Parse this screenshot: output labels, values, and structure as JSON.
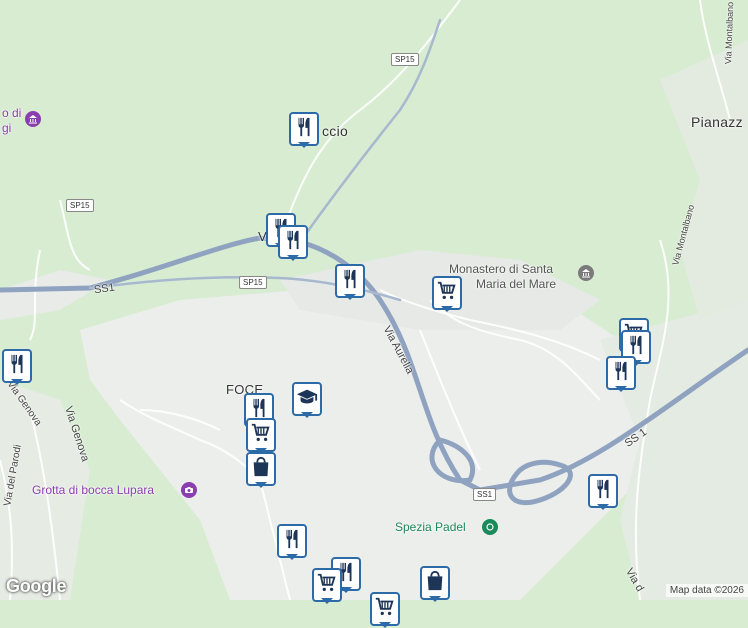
{
  "map": {
    "places": [
      {
        "key": "pianazze",
        "text": "Pianazz"
      },
      {
        "key": "foce",
        "text": "FOCE"
      },
      {
        "key": "accio",
        "text": "ccio"
      },
      {
        "key": "va",
        "text": "Va"
      }
    ],
    "pois": [
      {
        "key": "monastero",
        "line1": "Monastero di Santa",
        "line2": "Maria del Mare",
        "icon": "museum-icon"
      },
      {
        "key": "grotta",
        "text": "Grotta di bocca Lupara",
        "icon": "camera-icon"
      },
      {
        "key": "spezia_padel",
        "text": "Spezia Padel",
        "icon": "sports-icon"
      },
      {
        "key": "left_poi",
        "line1": "o di",
        "line2": "gi",
        "icon": "museum-icon"
      }
    ],
    "roads": [
      {
        "key": "via_aurelia",
        "text": "Via Aurelia"
      },
      {
        "key": "via_genova",
        "text": "Via Genova"
      },
      {
        "key": "via_montalbano_1",
        "text": "Via Montalbano"
      },
      {
        "key": "via_montalbano_2",
        "text": "Via Montalbano"
      },
      {
        "key": "via_del_parodi",
        "text": "Via del Parodi"
      },
      {
        "key": "via_genova_2",
        "text": "Via Genova"
      },
      {
        "key": "via_bottom",
        "text": "Via d"
      }
    ],
    "shields": [
      {
        "key": "sp15_top",
        "text": "SP15"
      },
      {
        "key": "sp15_left",
        "text": "SP15"
      },
      {
        "key": "sp15_mid",
        "text": "SP15"
      },
      {
        "key": "ss1_left",
        "text": "SS1"
      },
      {
        "key": "ss1_bottom",
        "text": "SS1"
      },
      {
        "key": "ss1_right",
        "text": "SS 1"
      }
    ],
    "markers": [
      {
        "type": "restaurant",
        "icon": "fork-knife-icon"
      },
      {
        "type": "restaurant",
        "icon": "fork-knife-icon"
      },
      {
        "type": "restaurant",
        "icon": "fork-knife-icon"
      },
      {
        "type": "restaurant",
        "icon": "fork-knife-icon"
      },
      {
        "type": "grocery",
        "icon": "shopping-cart-icon"
      },
      {
        "type": "restaurant",
        "icon": "fork-knife-icon"
      },
      {
        "type": "grocery",
        "icon": "shopping-cart-icon"
      },
      {
        "type": "restaurant",
        "icon": "fork-knife-icon"
      },
      {
        "type": "restaurant",
        "icon": "fork-knife-icon"
      },
      {
        "type": "restaurant",
        "icon": "fork-knife-icon"
      },
      {
        "type": "school",
        "icon": "graduation-cap-icon"
      },
      {
        "type": "restaurant",
        "icon": "fork-knife-icon"
      },
      {
        "type": "grocery",
        "icon": "shopping-cart-icon"
      },
      {
        "type": "shopping",
        "icon": "shopping-bag-icon"
      },
      {
        "type": "restaurant",
        "icon": "fork-knife-icon"
      },
      {
        "type": "restaurant",
        "icon": "fork-knife-icon"
      },
      {
        "type": "grocery",
        "icon": "shopping-cart-icon"
      },
      {
        "type": "grocery",
        "icon": "shopping-cart-icon"
      },
      {
        "type": "shopping",
        "icon": "shopping-bag-icon"
      },
      {
        "type": "grocery",
        "icon": "shopping-cart-icon"
      }
    ]
  },
  "footer": {
    "logo": "Google",
    "attribution": "Map data ©2026"
  },
  "colors": {
    "land": "#d8ecd2",
    "urban": "#eef0ee",
    "highway": "#8fa3c0",
    "marker_border": "#2d6aa8",
    "poi_purple": "#8a3fb0",
    "sport_green": "#1a8a5a"
  }
}
